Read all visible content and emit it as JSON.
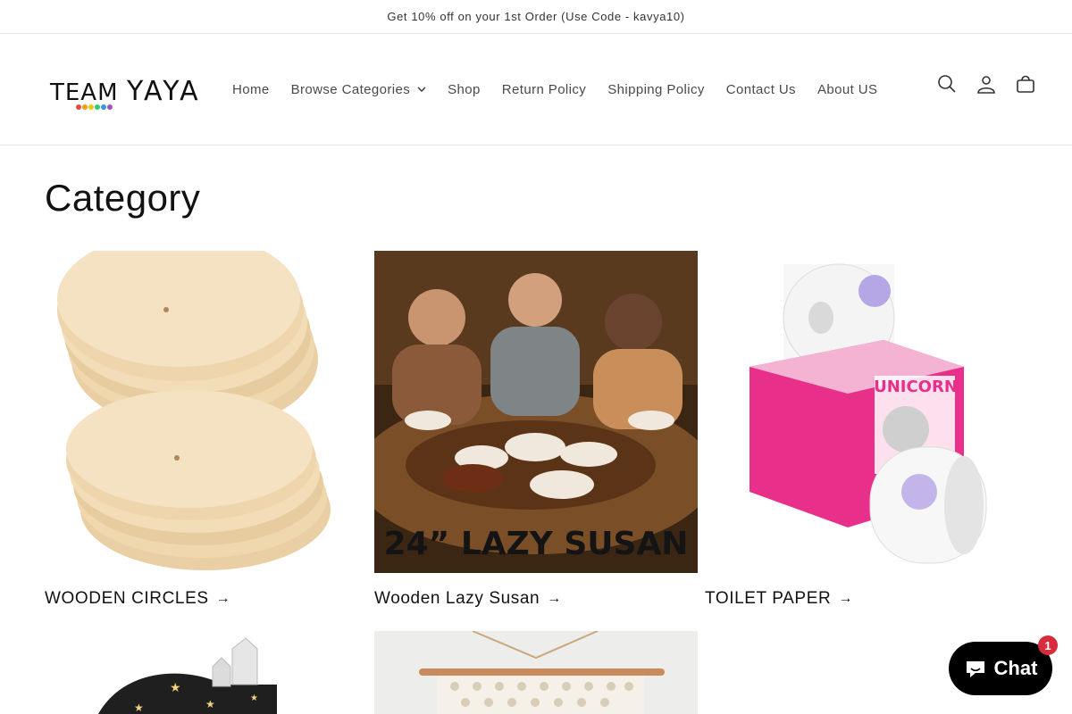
{
  "announcement": {
    "text": "Get 10% off on your 1st Order (Use Code - kavya10)"
  },
  "header": {
    "logo_text": "TEAM YAYA",
    "nav": [
      {
        "label": "Home"
      },
      {
        "label": "Browse Categories",
        "has_dropdown": true
      },
      {
        "label": "Shop"
      },
      {
        "label": "Return Policy"
      },
      {
        "label": "Shipping Policy"
      },
      {
        "label": "Contact Us"
      },
      {
        "label": "About US"
      }
    ],
    "icons": [
      "search-icon",
      "account-icon",
      "cart-icon"
    ]
  },
  "main": {
    "title": "Category",
    "categories": [
      {
        "label": "WOODEN CIRCLES",
        "image": "wooden-circles-image"
      },
      {
        "label": "Wooden Lazy Susan",
        "image": "lazy-susan-image",
        "image_text": "24” LAZY SUSAN"
      },
      {
        "label": "TOILET PAPER",
        "image": "unicorn-toilet-paper-image",
        "image_text": "UNICORN"
      },
      {
        "label": "",
        "image": "crystal-display-image"
      },
      {
        "label": "",
        "image": "macrame-wall-hanging-image"
      }
    ]
  },
  "chat": {
    "label": "Chat",
    "badge": "1"
  },
  "colors": {
    "text": "#121212",
    "chat_bg": "#000000",
    "badge": "#d62c3c"
  }
}
